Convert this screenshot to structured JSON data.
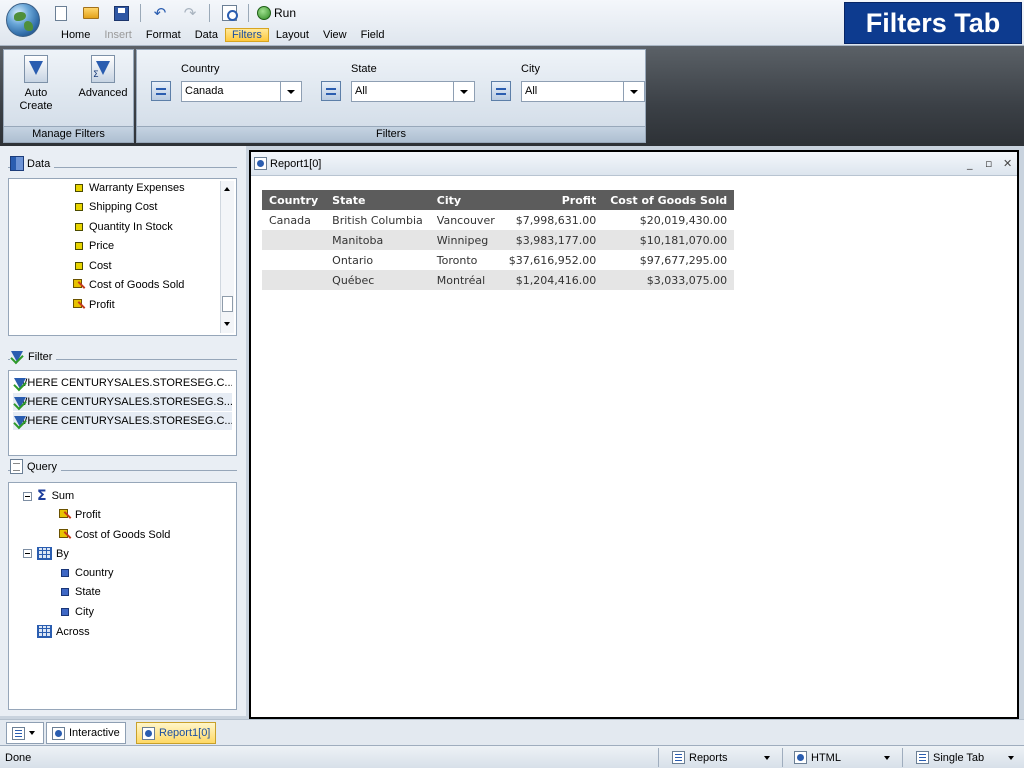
{
  "banner": {
    "title": "Filters Tab"
  },
  "quick_access": {
    "run_label": "Run"
  },
  "menu": [
    "Home",
    "Insert",
    "Format",
    "Data",
    "Filters",
    "Layout",
    "View",
    "Field"
  ],
  "ribbon": {
    "manage_filters": {
      "caption": "Manage Filters",
      "auto_create_label": "Auto Create",
      "advanced_label": "Advanced"
    },
    "filters": {
      "caption": "Filters",
      "country": {
        "label": "Country",
        "value": "Canada"
      },
      "state": {
        "label": "State",
        "value": "All"
      },
      "city": {
        "label": "City",
        "value": "All"
      }
    }
  },
  "data_panel": {
    "title": "Data",
    "fields": [
      {
        "label": "Warranty Expenses",
        "icon": "field-icon"
      },
      {
        "label": "Shipping Cost",
        "icon": "field-icon"
      },
      {
        "label": "Quantity In Stock",
        "icon": "field-icon"
      },
      {
        "label": "Price",
        "icon": "field-icon"
      },
      {
        "label": "Cost",
        "icon": "field-icon"
      },
      {
        "label": "Cost of Goods Sold",
        "icon": "calculated-field-icon"
      },
      {
        "label": "Profit",
        "icon": "calculated-field-icon"
      }
    ]
  },
  "filter_panel": {
    "title": "Filter",
    "items": [
      "WHERE CENTURYSALES.STORESEG.C...",
      "WHERE CENTURYSALES.STORESEG.S...",
      "WHERE CENTURYSALES.STORESEG.C..."
    ]
  },
  "query_panel": {
    "title": "Query",
    "sum_label": "Sum",
    "sum_fields": [
      "Profit",
      "Cost of Goods Sold"
    ],
    "by_label": "By",
    "by_fields": [
      "Country",
      "State",
      "City"
    ],
    "across_label": "Across"
  },
  "report": {
    "title": "Report1[0]",
    "columns": [
      "Country",
      "State",
      "City",
      "Profit",
      "Cost of Goods Sold"
    ],
    "rows": [
      [
        "Canada",
        "British Columbia",
        "Vancouver",
        "$7,998,631.00",
        "$20,019,430.00"
      ],
      [
        "",
        "Manitoba",
        "Winnipeg",
        "$3,983,177.00",
        "$10,181,070.00"
      ],
      [
        "",
        "Ontario",
        "Toronto",
        "$37,616,952.00",
        "$97,677,295.00"
      ],
      [
        "",
        "Québec",
        "Montréal",
        "$1,204,416.00",
        "$3,033,075.00"
      ]
    ]
  },
  "bottom_tabs": {
    "interactive_label": "Interactive",
    "report_label": "Report1[0]"
  },
  "status": {
    "text": "Done",
    "reports_label": "Reports",
    "format_label": "HTML",
    "tab_mode_label": "Single Tab"
  },
  "colors": {
    "banner": "#0d3b8f",
    "active_tab": "#ffd966",
    "header_row": "#5c5c5c"
  }
}
